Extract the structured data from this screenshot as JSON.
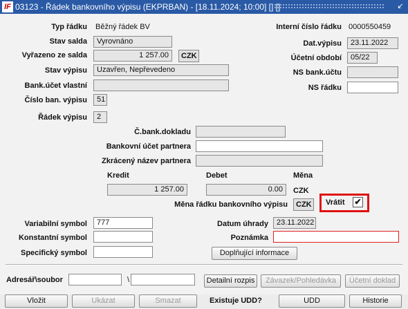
{
  "window": {
    "title": "03123 - Řádek bankovního výpisu (EKPRBAN) - [18.11.2024; 10:00] [] []",
    "logo_text": "IF",
    "close_glyph": "↙",
    "logo_icon": "app-logo-icon"
  },
  "form": {
    "typ_radku": {
      "label": "Typ řádku",
      "value": "Běžný řádek BV"
    },
    "stav_salda": {
      "label": "Stav salda",
      "value": "Vyrovnáno"
    },
    "vyrazeno": {
      "label": "Vyřazeno ze salda",
      "value": "1 257.00",
      "currency": "CZK"
    },
    "stav_vypisu": {
      "label": "Stav výpisu",
      "value": "Uzavřen, Nepřevedeno"
    },
    "bank_ucet_vlastni": {
      "label": "Bank.účet vlastní",
      "value": ""
    },
    "cislo_ban_vypisu": {
      "label": "Číslo ban. výpisu",
      "value": "51"
    },
    "radek_vypisu": {
      "label": "Řádek výpisu",
      "value": "2"
    },
    "interni_cislo": {
      "label": "Interní číslo řádku",
      "value": "0000550459"
    },
    "dat_vypisu": {
      "label": "Dat.výpisu",
      "value": "23.11.2022"
    },
    "ucetni_obdobi": {
      "label": "Účetní období",
      "value": "05/22"
    },
    "ns_bank_uctu": {
      "label": "NS bank.účtu",
      "value": ""
    },
    "ns_radku": {
      "label": "NS řádku",
      "value": ""
    },
    "c_bank_doklad": {
      "label": "Č.bank.dokladu",
      "value": ""
    },
    "bank_ucet_partnera": {
      "label": "Bankovní účet partnera",
      "value": ""
    },
    "zkraceny_nazev": {
      "label": "Zkrácený název partnera",
      "value": ""
    },
    "kredit": {
      "label": "Kredit",
      "value": "1 257.00"
    },
    "debet": {
      "label": "Debet",
      "value": "0.00"
    },
    "mena": {
      "label": "Měna",
      "value": "CZK"
    },
    "mena_radku": {
      "label": "Měna řádku bankovního výpisu",
      "value": "CZK"
    },
    "vratit": {
      "label": "Vrátit",
      "checked": true,
      "check_glyph": "✔"
    },
    "variabilni": {
      "label": "Variabilní symbol",
      "value": "777"
    },
    "konstantni": {
      "label": "Konstantní symbol",
      "value": ""
    },
    "specificky": {
      "label": "Specifický symbol",
      "value": ""
    },
    "datum_uhrady": {
      "label": "Datum úhrady",
      "value": "23.11.2022"
    },
    "poznamka": {
      "label": "Poznámka",
      "value": ""
    },
    "doplnujici_btn": "Doplňující informace"
  },
  "files": {
    "label": "Adresář\\soubor",
    "dir_value": "",
    "separator": "\\",
    "file_value": "",
    "detailni_btn": "Detailní rozpis",
    "zavazek_btn": "Závazek/Pohledávka",
    "ucetni_btn": "Účetní doklad"
  },
  "footer": {
    "vlozit": "Vložit",
    "ukazat": "Ukázat",
    "smazat": "Smazat",
    "existuje": "Existuje UDD?",
    "udd": "UDD",
    "historie": "Historie"
  },
  "colors": {
    "titlebar": "#2a5aa6",
    "highlight": "#e01010",
    "required_border": "#e02020"
  }
}
